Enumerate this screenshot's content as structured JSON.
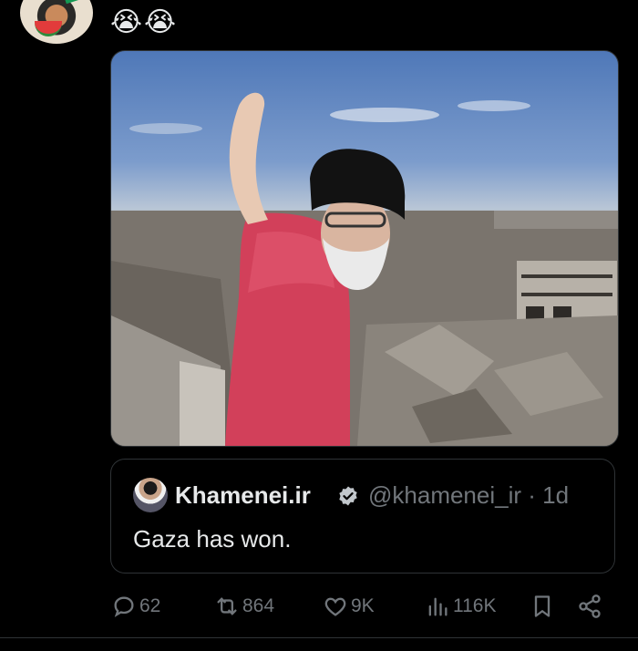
{
  "post": {
    "text": "😭😭"
  },
  "quote": {
    "name": "Khamenei.ir",
    "handle": "@khamenei_ir",
    "separator": "·",
    "time": "1d",
    "text": "Gaza has won."
  },
  "actions": {
    "replies": "62",
    "reposts": "864",
    "likes": "9K",
    "views": "116K"
  },
  "colors": {
    "background": "#000000",
    "text": "#e7e9ea",
    "muted": "#71767b",
    "border": "#2f3336",
    "verified": "#1d9bf0"
  },
  "icons": [
    "reply-icon",
    "repost-icon",
    "like-icon",
    "views-icon",
    "bookmark-icon",
    "share-icon",
    "verified-badge-icon"
  ]
}
